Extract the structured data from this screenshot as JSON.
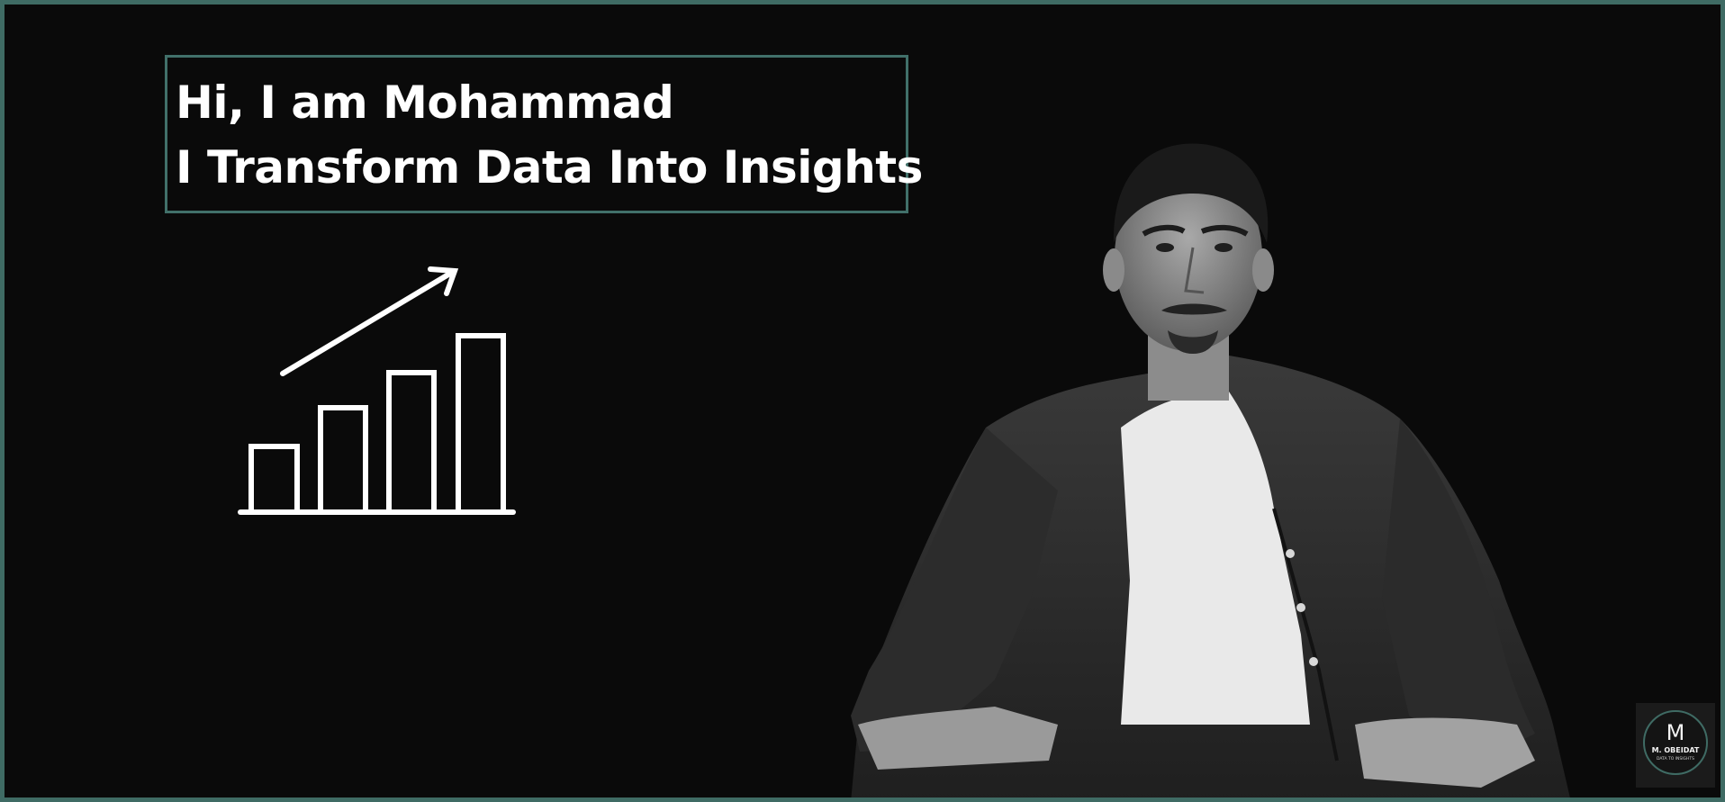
{
  "header": {
    "line1": "Hi, I am Mohammad",
    "line2": "I Transform Data Into Insights"
  },
  "icons": {
    "growth": "bar-chart-growth-icon"
  },
  "photo": {
    "description_name": "portrait-photo"
  },
  "logo": {
    "letter": "M",
    "name": "M. OBEIDAT",
    "tagline": "DATA TO INSIGHTS"
  },
  "colors": {
    "background": "#0a0a0a",
    "accent": "#3f6b64",
    "text": "#ffffff"
  }
}
